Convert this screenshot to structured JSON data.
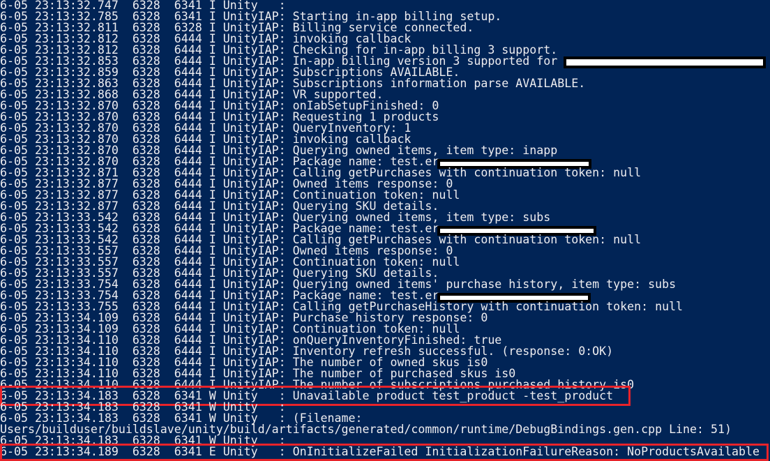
{
  "colors": {
    "background": "#012456",
    "text": "#eeedf0",
    "highlight": "#e8232a"
  },
  "lines": [
    {
      "text": "6-05 23:13:32.747  6328  6341 I Unity   :"
    },
    {
      "text": "6-05 23:13:32.785  6328  6341 I UnityIAP: Starting in-app billing setup."
    },
    {
      "text": "6-05 23:13:32.811  6328  6328 I UnityIAP: Billing service connected."
    },
    {
      "text": "6-05 23:13:32.812  6328  6444 I UnityIAP: invoking callback"
    },
    {
      "text": "6-05 23:13:32.812  6328  6444 I UnityIAP: Checking for in-app billing 3 support."
    },
    {
      "text": "6-05 23:13:32.853  6328  6444 I UnityIAP: In-app billing version 3 supported for",
      "redacted": true
    },
    {
      "text": "6-05 23:13:32.859  6328  6444 I UnityIAP: Subscriptions AVAILABLE."
    },
    {
      "text": "6-05 23:13:32.863  6328  6444 I UnityIAP: Subscriptions information parse AVAILABLE."
    },
    {
      "text": "6-05 23:13:32.868  6328  6444 I UnityIAP: VR supported."
    },
    {
      "text": "6-05 23:13:32.870  6328  6444 I UnityIAP: onIabSetupFinished: 0"
    },
    {
      "text": "6-05 23:13:32.870  6328  6444 I UnityIAP: Requesting 1 products"
    },
    {
      "text": "6-05 23:13:32.870  6328  6444 I UnityIAP: QueryInventory: 1"
    },
    {
      "text": "6-05 23:13:32.870  6328  6444 I UnityIAP: invoking callback"
    },
    {
      "text": "6-05 23:13:32.870  6328  6444 I UnityIAP: Querying owned items, item type: inapp"
    },
    {
      "text": "6-05 23:13:32.870  6328  6444 I UnityIAP: Package name: test.er",
      "redacted": true
    },
    {
      "text": "6-05 23:13:32.871  6328  6444 I UnityIAP: Calling getPurchases with continuation token: null"
    },
    {
      "text": "6-05 23:13:32.877  6328  6444 I UnityIAP: Owned items response: 0"
    },
    {
      "text": "6-05 23:13:32.877  6328  6444 I UnityIAP: Continuation token: null"
    },
    {
      "text": "6-05 23:13:32.877  6328  6444 I UnityIAP: Querying SKU details."
    },
    {
      "text": "6-05 23:13:33.542  6328  6444 I UnityIAP: Querying owned items, item type: subs"
    },
    {
      "text": "6-05 23:13:33.542  6328  6444 I UnityIAP: Package name: test.er",
      "redacted": true
    },
    {
      "text": "6-05 23:13:33.542  6328  6444 I UnityIAP: Calling getPurchases with continuation token: null"
    },
    {
      "text": "6-05 23:13:33.557  6328  6444 I UnityIAP: Owned items response: 0"
    },
    {
      "text": "6-05 23:13:33.557  6328  6444 I UnityIAP: Continuation token: null"
    },
    {
      "text": "6-05 23:13:33.557  6328  6444 I UnityIAP: Querying SKU details."
    },
    {
      "text": "6-05 23:13:33.754  6328  6444 I UnityIAP: Querying owned items' purchase history, item type: subs"
    },
    {
      "text": "6-05 23:13:33.754  6328  6444 I UnityIAP: Package name: test.er",
      "redacted": true
    },
    {
      "text": "6-05 23:13:33.755  6328  6444 I UnityIAP: Calling getPurchaseHistory with continuation token: null"
    },
    {
      "text": "6-05 23:13:34.109  6328  6444 I UnityIAP: Purchase history response: 0"
    },
    {
      "text": "6-05 23:13:34.109  6328  6444 I UnityIAP: Continuation token: null"
    },
    {
      "text": "6-05 23:13:34.110  6328  6444 I UnityIAP: onQueryInventoryFinished: true"
    },
    {
      "text": "6-05 23:13:34.110  6328  6444 I UnityIAP: Inventory refresh successful. (response: 0:OK)"
    },
    {
      "text": "6-05 23:13:34.110  6328  6444 I UnityIAP: The number of owned skus is0"
    },
    {
      "text": "6-05 23:13:34.110  6328  6444 I UnityIAP: The number of purchased skus is0"
    },
    {
      "text": "6-05 23:13:34.110  6328  6444 I UnityIAP: The number of subscriptions purchased history is0"
    },
    {
      "text": "6-05 23:13:34.183  6328  6341 W Unity   : Unavailable product test_product -test_product",
      "highlighted": true
    },
    {
      "text": "6-05 23:13:34.183  6328  6341 W Unity   :"
    },
    {
      "text": "6-05 23:13:34.183  6328  6341 W Unity   : (Filename:"
    },
    {
      "text": "Users/builduser/buildslave/unity/build/artifacts/generated/common/runtime/DebugBindings.gen.cpp Line: 51)"
    },
    {
      "text": "6-05 23:13:34.183  6328  6341 W Unity   :"
    },
    {
      "text": "6-05 23:13:34.189  6328  6341 E Unity   : OnInitializeFailed InitializationFailureReason: NoProductsAvailable",
      "highlighted": true
    }
  ]
}
